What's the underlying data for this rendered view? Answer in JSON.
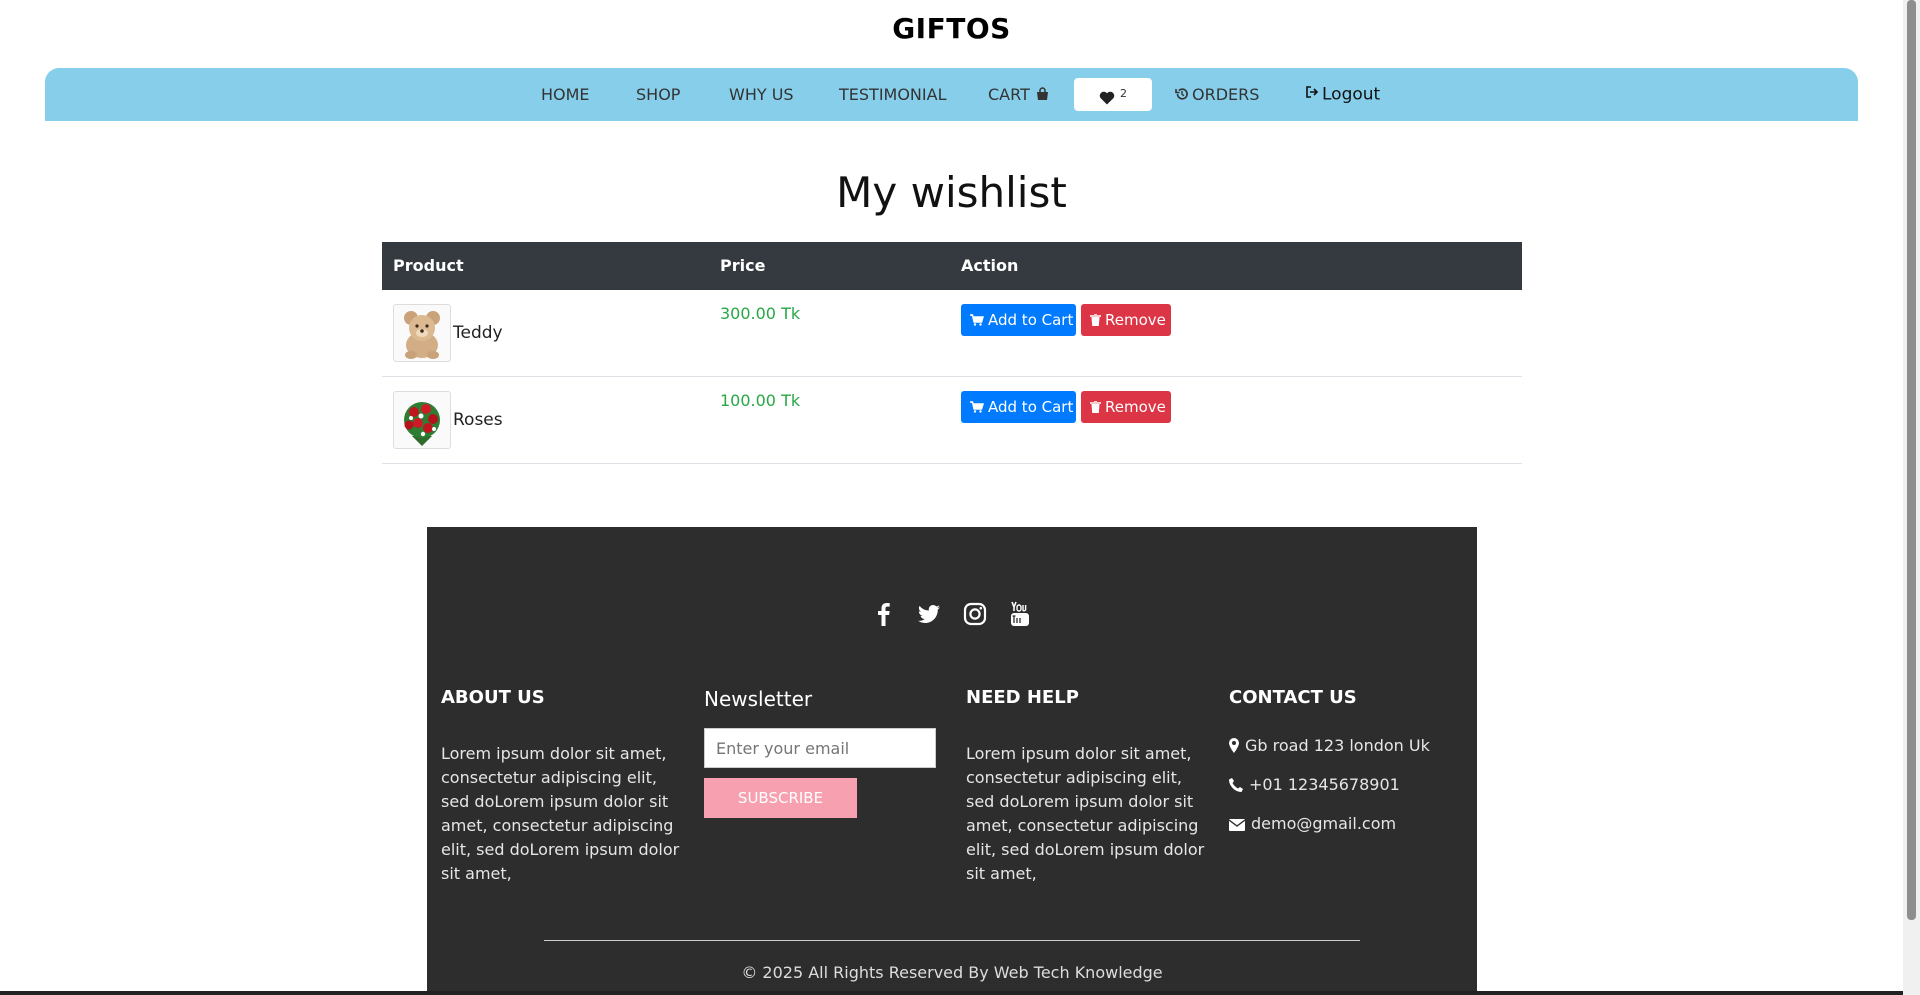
{
  "brand": "GIFTOS",
  "nav": {
    "home": "HOME",
    "shop": "SHOP",
    "why": "WHY US",
    "testimonial": "TESTIMONIAL",
    "cart": "CART",
    "wishlist_count": "2",
    "orders": "ORDERS",
    "logout": "Logout"
  },
  "page_title": "My wishlist",
  "table": {
    "headers": [
      "Product",
      "Price",
      "Action"
    ],
    "rows": [
      {
        "name": "Teddy",
        "price": "300.00 Tk",
        "add_label": "Add to Cart",
        "remove_label": "Remove",
        "image": "teddy-bear"
      },
      {
        "name": "Roses",
        "price": "100.00 Tk",
        "add_label": "Add to Cart",
        "remove_label": "Remove",
        "image": "red-roses-bouquet"
      }
    ]
  },
  "footer": {
    "social": [
      "facebook-icon",
      "twitter-icon",
      "instagram-icon",
      "youtube-icon"
    ],
    "about": {
      "title": "ABOUT US",
      "text": "Lorem ipsum dolor sit amet, consectetur adipiscing elit, sed doLorem ipsum dolor sit amet, consectetur adipiscing elit, sed doLorem ipsum dolor sit amet,"
    },
    "newsletter": {
      "title": "Newsletter",
      "placeholder": "Enter your email",
      "button": "SUBSCRIBE"
    },
    "help": {
      "title": "NEED HELP",
      "text": "Lorem ipsum dolor sit amet, consectetur adipiscing elit, sed doLorem ipsum dolor sit amet, consectetur adipiscing elit, sed doLorem ipsum dolor sit amet,"
    },
    "contact": {
      "title": "CONTACT US",
      "address": "Gb road 123 london Uk",
      "phone": "+01 12345678901",
      "email": "demo@gmail.com"
    },
    "copyright": "© 2025 All Rights Reserved By Web Tech Knowledge"
  },
  "colors": {
    "nav_bg": "#87ceeb",
    "table_head": "#343a40",
    "price": "#28a745",
    "add_btn": "#007bff",
    "remove_btn": "#dc3545",
    "footer_bg": "#2d2d2d",
    "subscribe": "#f7a1b0"
  }
}
